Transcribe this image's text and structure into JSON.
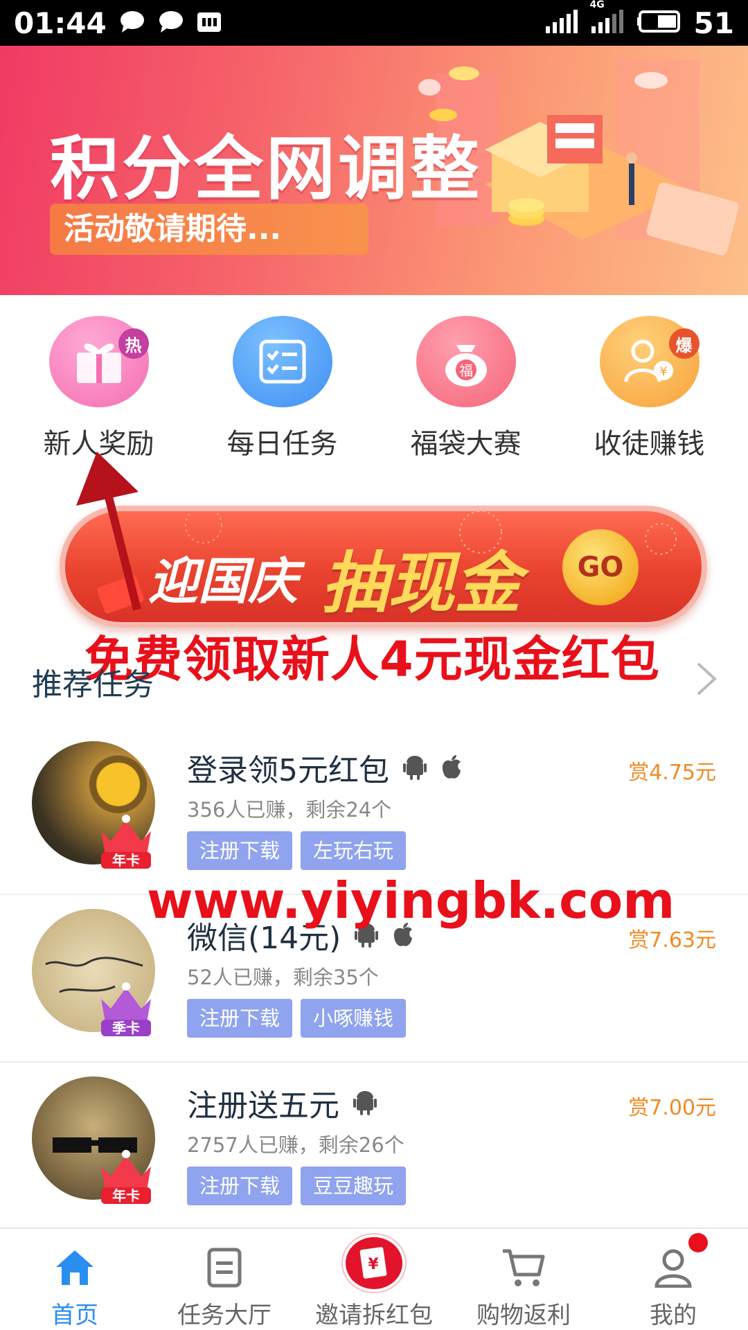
{
  "status_bar": {
    "time": "01:44",
    "network": "4G",
    "battery": "51",
    "icons": [
      "chat-bubble-icon",
      "chat-bubble-icon",
      "sim-card-icon",
      "signal-icon",
      "signal-4g-icon",
      "battery-icon"
    ]
  },
  "banner": {
    "title": "积分全网调整",
    "subtitle": "活动敬请期待...",
    "slide_count": 3,
    "active_slide": 1
  },
  "quick_menu": [
    {
      "label": "新人奖励",
      "icon": "gift-icon",
      "badge": "热",
      "color": "#f46fb0"
    },
    {
      "label": "每日任务",
      "icon": "checklist-icon",
      "badge": "",
      "color": "#3f8ff2"
    },
    {
      "label": "福袋大赛",
      "icon": "lucky-bag-icon",
      "badge": "福",
      "color": "#f5657a"
    },
    {
      "label": "收徒赚钱",
      "icon": "users-coin-icon",
      "badge": "爆",
      "color": "#f7a23a"
    }
  ],
  "promo": {
    "text_a": "迎国庆",
    "text_b": "抽现金",
    "go": "GO"
  },
  "overlay": {
    "caption": "免费领取新人4元现金红包",
    "url": "www.yiyingbk.com"
  },
  "section": {
    "title": "推荐任务"
  },
  "tasks": [
    {
      "title": "登录领5元红包",
      "platforms": [
        "android-icon",
        "apple-icon"
      ],
      "stats": "356人已赚，剩余24个",
      "reward": "赏4.75元",
      "tags": [
        "注册下载",
        "左玩右玩"
      ],
      "crown": "年卡"
    },
    {
      "title": "微信(14元)",
      "platforms": [
        "android-icon",
        "apple-icon"
      ],
      "stats": "52人已赚，剩余35个",
      "reward": "赏7.63元",
      "tags": [
        "注册下载",
        "小啄赚钱"
      ],
      "crown": "季卡"
    },
    {
      "title": "注册送五元",
      "platforms": [
        "android-icon"
      ],
      "stats": "2757人已赚，剩余26个",
      "reward": "赏7.00元",
      "tags": [
        "注册下载",
        "豆豆趣玩"
      ],
      "crown": "年卡"
    }
  ],
  "bottom_nav": [
    {
      "label": "首页",
      "icon": "home-icon",
      "active": true
    },
    {
      "label": "任务大厅",
      "icon": "document-icon",
      "active": false
    },
    {
      "label": "邀请拆红包",
      "icon": "red-envelope-icon",
      "active": false
    },
    {
      "label": "购物返利",
      "icon": "cart-icon",
      "active": false
    },
    {
      "label": "我的",
      "icon": "user-icon",
      "active": false
    }
  ],
  "colors": {
    "accent_blue": "#2a8df0",
    "reward_orange": "#f08a23",
    "tag_blue": "#8fa3ee",
    "overlay_red": "#e8101a"
  }
}
